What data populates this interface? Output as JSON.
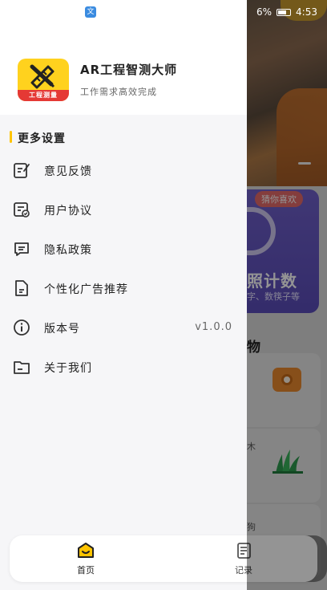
{
  "status_bar": {
    "battery_text": "6%",
    "time": "4:53"
  },
  "background": {
    "card_tag": "猜你喜欢",
    "card_title": "照计数",
    "card_subtitle": "字、数筷子等",
    "section_title": "物",
    "item_labels": [
      "木",
      "狗"
    ]
  },
  "drawer": {
    "app_name": "AR工程智测大师",
    "app_slogan": "工作需求高效完成",
    "logo_text": "工程测量",
    "section_title": "更多设置",
    "menu": [
      {
        "label": "意见反馈",
        "icon": "feedback-icon"
      },
      {
        "label": "用户协议",
        "icon": "user-agreement-icon"
      },
      {
        "label": "隐私政策",
        "icon": "privacy-policy-icon"
      },
      {
        "label": "个性化广告推荐",
        "icon": "ad-recommend-icon"
      },
      {
        "label": "版本号",
        "icon": "info-icon",
        "value": "v1.0.0"
      },
      {
        "label": "关于我们",
        "icon": "folder-icon"
      }
    ]
  },
  "bottom_nav": {
    "tabs": [
      {
        "label": "首页",
        "icon": "home-icon",
        "active": true
      },
      {
        "label": "记录",
        "icon": "record-icon",
        "active": false
      }
    ]
  },
  "colors": {
    "accent": "#ffc400",
    "logo_bg": "#ffd21e",
    "logo_stripe": "#e53935",
    "card": "#6f60c9"
  }
}
